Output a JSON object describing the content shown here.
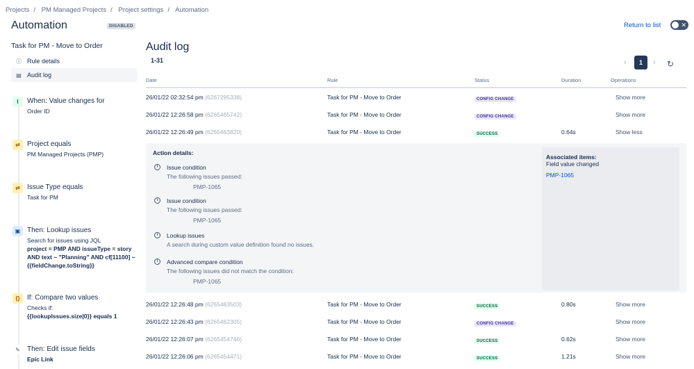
{
  "breadcrumbs": [
    "Projects",
    "PM Managed Projects",
    "Project settings",
    "Automation"
  ],
  "header": {
    "title": "Automation",
    "status_badge": "DISABLED",
    "return_link": "Return to list",
    "toggle_state": "off"
  },
  "sidebar": {
    "rule_name": "Task for PM - Move to Order",
    "nav": [
      {
        "label": "Rule details",
        "icon": "info-icon"
      },
      {
        "label": "Audit log",
        "icon": "log-icon",
        "active": true
      }
    ],
    "steps": [
      {
        "title": "When: Value changes for",
        "desc": "Order ID",
        "icon": "trigger-icon"
      },
      {
        "title": "Project equals",
        "desc": "PM Managed Projects (PMP)",
        "icon": "condition-icon"
      },
      {
        "title": "Issue Type equals",
        "desc": "Task for PM",
        "icon": "condition-icon"
      },
      {
        "title": "Then: Lookup issues",
        "desc": "Search for issues using JQL",
        "desc_bold": "project = PMP AND issueType = story AND text ~ \"Planning\" AND cf[11100] ~ {{fieldChange.toString}}",
        "icon": "lookup-icon"
      },
      {
        "title": "If: Compare two values",
        "desc": "Checks if:",
        "desc_bold": "{{lookupIssues.size|0}} equals 1",
        "icon": "braces-icon"
      },
      {
        "title": "Then: Edit issue fields",
        "desc_bold": "Epic Link",
        "icon": "edit-icon"
      }
    ]
  },
  "main": {
    "title": "Audit log",
    "range": "1-31",
    "pager": {
      "current": "1"
    },
    "columns": [
      "Date",
      "Rule",
      "Status",
      "Duration",
      "Operations"
    ],
    "rows_top": [
      {
        "date": "26/01/22 02:32:54 pm",
        "id": "(6267295338)",
        "rule": "Task for PM - Move to Order",
        "status": "CONFIG CHANGE",
        "duration": "",
        "op": "Show more"
      },
      {
        "date": "26/01/22 12:26:58 pm",
        "id": "(6265465742)",
        "rule": "Task for PM - Move to Order",
        "status": "CONFIG CHANGE",
        "duration": "",
        "op": "Show more"
      },
      {
        "date": "26/01/22 12:26:49 pm",
        "id": "(6265463820)",
        "rule": "Task for PM - Move to Order",
        "status": "SUCCESS",
        "duration": "0.64s",
        "op": "Show less"
      }
    ],
    "details": {
      "heading": "Action details:",
      "actions": [
        {
          "name": "Issue condition",
          "desc": "The following issues passed:",
          "issue": "PMP-1065"
        },
        {
          "name": "Issue condition",
          "desc": "The following issues passed:",
          "issue": "PMP-1065"
        },
        {
          "name": "Lookup issues",
          "desc": "A search during custom value definition found no issues.",
          "issue": ""
        },
        {
          "name": "Advanced compare condition",
          "desc": "The following issues did not match the condition:",
          "issue": "PMP-1065"
        }
      ],
      "associated": {
        "heading": "Associated items:",
        "sub": "Field value changed",
        "link": "PMP-1065"
      }
    },
    "rows_bottom": [
      {
        "date": "26/01/22 12:26:48 pm",
        "id": "(6265463503)",
        "rule": "Task for PM - Move to Order",
        "status": "SUCCESS",
        "duration": "0.80s",
        "op": "Show more"
      },
      {
        "date": "26/01/22 12:26:43 pm",
        "id": "(6265462305)",
        "rule": "Task for PM - Move to Order",
        "status": "CONFIG CHANGE",
        "duration": "",
        "op": "Show more"
      },
      {
        "date": "26/01/22 12:26:07 pm",
        "id": "(6265454746)",
        "rule": "Task for PM - Move to Order",
        "status": "SUCCESS",
        "duration": "0.62s",
        "op": "Show more"
      },
      {
        "date": "26/01/22 12:26:06 pm",
        "id": "(6265454471)",
        "rule": "Task for PM - Move to Order",
        "status": "SUCCESS",
        "duration": "1.21s",
        "op": "Show more"
      }
    ]
  },
  "colors": {
    "config": "#403294",
    "success": "#006644",
    "link": "#0052cc"
  }
}
